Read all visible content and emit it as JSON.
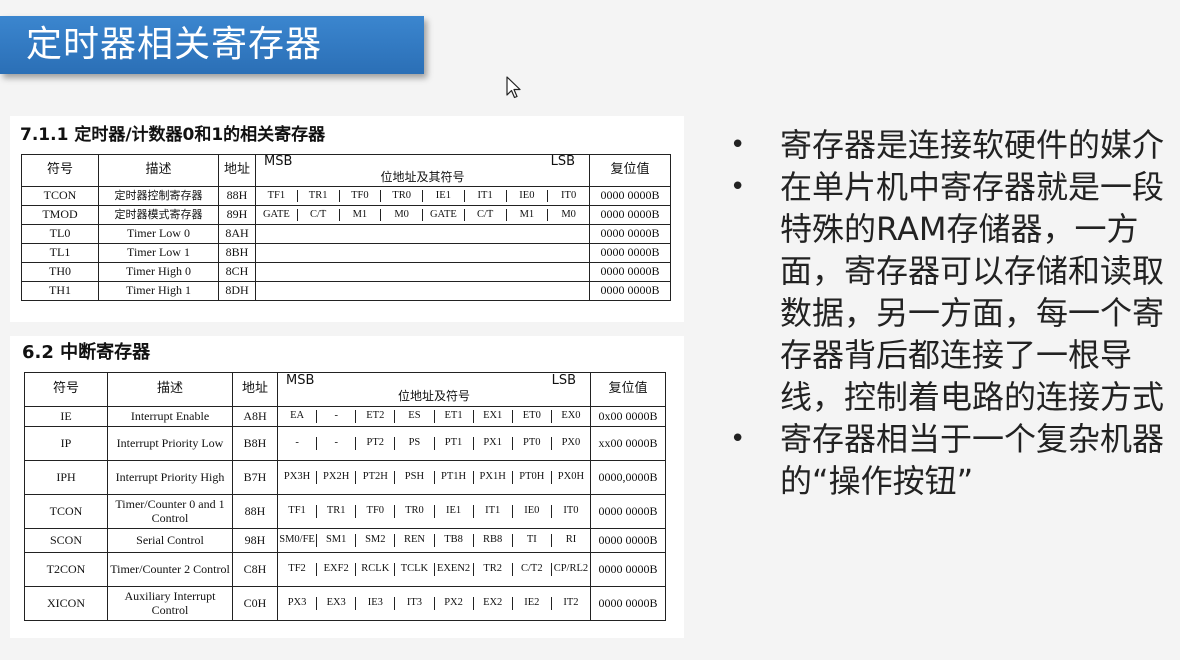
{
  "header": {
    "title": "定时器相关寄存器"
  },
  "table1": {
    "heading": "7.1.1  定时器/计数器0和1的相关寄存器",
    "columns": {
      "symbol": "符号",
      "desc": "描述",
      "addr": "地址",
      "bits": "位地址及其符号",
      "msb": "MSB",
      "lsb": "LSB",
      "reset": "复位值"
    },
    "rows": [
      {
        "symbol": "TCON",
        "desc": "定时器控制寄存器",
        "addr": "88H",
        "bits": [
          "TF1",
          "TR1",
          "TF0",
          "TR0",
          "IE1",
          "IT1",
          "IE0",
          "IT0"
        ],
        "reset": "0000 0000B"
      },
      {
        "symbol": "TMOD",
        "desc": "定时器模式寄存器",
        "addr": "89H",
        "bits": [
          "GATE",
          "C/T̄",
          "M1",
          "M0",
          "GATE",
          "C/T̄",
          "M1",
          "M0"
        ],
        "reset": "0000 0000B"
      },
      {
        "symbol": "TL0",
        "desc": "Timer Low 0",
        "addr": "8AH",
        "bits": [],
        "reset": "0000 0000B"
      },
      {
        "symbol": "TL1",
        "desc": "Timer Low 1",
        "addr": "8BH",
        "bits": [],
        "reset": "0000 0000B"
      },
      {
        "symbol": "TH0",
        "desc": "Timer High 0",
        "addr": "8CH",
        "bits": [],
        "reset": "0000 0000B"
      },
      {
        "symbol": "TH1",
        "desc": "Timer High 1",
        "addr": "8DH",
        "bits": [],
        "reset": "0000 0000B"
      }
    ]
  },
  "table2": {
    "heading": "6.2  中断寄存器",
    "columns": {
      "symbol": "符号",
      "desc": "描述",
      "addr": "地址",
      "bits": "位地址及符号",
      "msb": "MSB",
      "lsb": "LSB",
      "reset": "复位值"
    },
    "rows": [
      {
        "symbol": "IE",
        "desc": "Interrupt Enable",
        "addr": "A8H",
        "bits": [
          "EA",
          "-",
          "ET2",
          "ES",
          "ET1",
          "EX1",
          "ET0",
          "EX0"
        ],
        "reset": "0x00 0000B"
      },
      {
        "symbol": "IP",
        "desc": "Interrupt Priority Low",
        "addr": "B8H",
        "bits": [
          "-",
          "-",
          "PT2",
          "PS",
          "PT1",
          "PX1",
          "PT0",
          "PX0"
        ],
        "reset": "xx00 0000B"
      },
      {
        "symbol": "IPH",
        "desc": "Interrupt Priority High",
        "addr": "B7H",
        "bits": [
          "PX3H",
          "PX2H",
          "PT2H",
          "PSH",
          "PT1H",
          "PX1H",
          "PT0H",
          "PX0H"
        ],
        "reset": "0000,0000B"
      },
      {
        "symbol": "TCON",
        "desc": "Timer/Counter 0 and 1 Control",
        "addr": "88H",
        "bits": [
          "TF1",
          "TR1",
          "TF0",
          "TR0",
          "IE1",
          "IT1",
          "IE0",
          "IT0"
        ],
        "reset": "0000 0000B"
      },
      {
        "symbol": "SCON",
        "desc": "Serial Control",
        "addr": "98H",
        "bits": [
          "SM0/FE",
          "SM1",
          "SM2",
          "REN",
          "TB8",
          "RB8",
          "TI",
          "RI"
        ],
        "reset": "0000 0000B"
      },
      {
        "symbol": "T2CON",
        "desc": "Timer/Counter 2 Control",
        "addr": "C8H",
        "bits": [
          "TF2",
          "EXF2",
          "RCLK",
          "TCLK",
          "EXEN2",
          "TR2",
          "C/T̄2",
          "CP/RL̄2"
        ],
        "reset": "0000 0000B"
      },
      {
        "symbol": "XICON",
        "desc": "Auxiliary Interrupt Control",
        "addr": "C0H",
        "bits": [
          "PX3",
          "EX3",
          "IE3",
          "IT3",
          "PX2",
          "EX2",
          "IE2",
          "IT2"
        ],
        "reset": "0000 0000B"
      }
    ]
  },
  "bullets": [
    "寄存器是连接软硬件的媒介",
    "在单片机中寄存器就是一段特殊的RAM存储器，一方面，寄存器可以存储和读取数据，另一方面，每一个寄存器背后都连接了一根导线，控制着电路的连接方式",
    "寄存器相当于一个复杂机器的“操作按钮”"
  ],
  "bullet_glyph": "•",
  "icons": {
    "cursor": "mouse-pointer-icon"
  }
}
